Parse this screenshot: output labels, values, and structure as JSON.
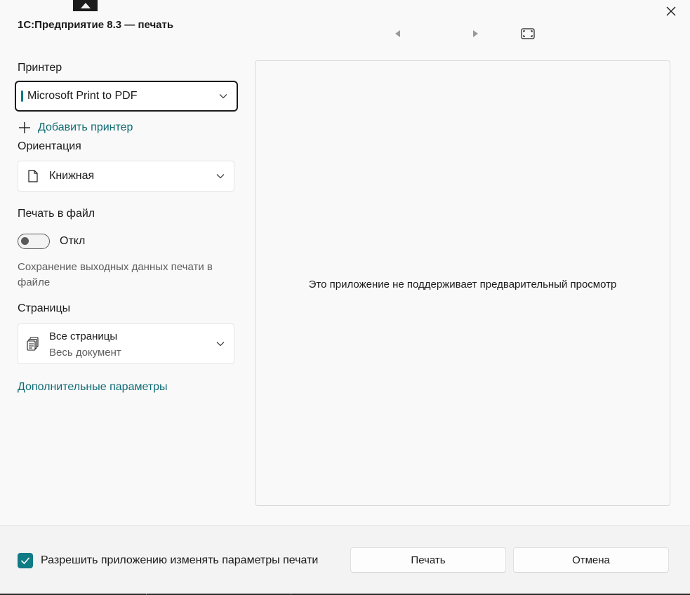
{
  "window": {
    "title": "1С:Предприятие 8.3 — печать"
  },
  "icons": {
    "collapse": "triangle-up-icon",
    "close": "close-icon",
    "prev": "previous-page-icon",
    "next": "next-page-icon",
    "fit": "fit-page-icon",
    "orientation": "document-icon",
    "pages": "pages-stack-icon"
  },
  "printer": {
    "label": "Принтер",
    "value": "Microsoft Print to PDF",
    "add_label": "Добавить принтер"
  },
  "orientation": {
    "label": "Ориентация",
    "value": "Книжная"
  },
  "print_to_file": {
    "label": "Печать в файл",
    "state": "Откл",
    "hint": "Сохранение выходных данных печати в файле"
  },
  "pages": {
    "label": "Страницы",
    "value": "Все страницы",
    "sub": "Весь документ"
  },
  "more_params": "Дополнительные параметры",
  "preview": {
    "message": "Это приложение не поддерживает предварительный просмотр"
  },
  "footer": {
    "allow_label": "Разрешить приложению изменять параметры печати",
    "allow_checked": true,
    "print_button": "Печать",
    "cancel_button": "Отмена"
  },
  "colors": {
    "accent": "#0f7b84",
    "link": "#0f6b74",
    "background": "#f9f9f9"
  }
}
